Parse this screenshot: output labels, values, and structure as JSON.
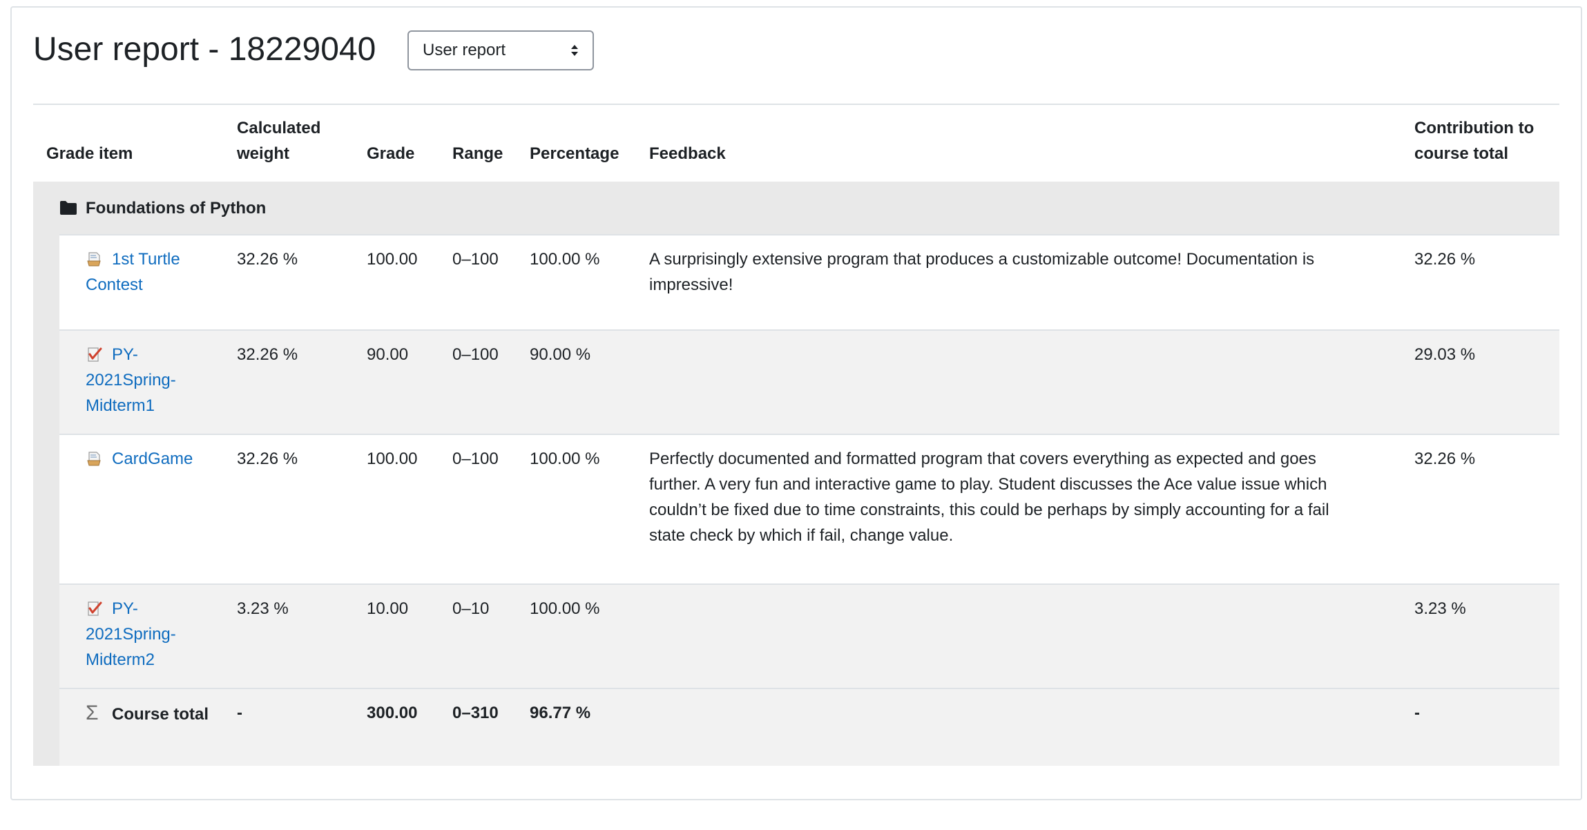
{
  "page": {
    "title": "User report - 18229040",
    "report_select": {
      "value": "User report"
    }
  },
  "table": {
    "headers": {
      "grade_item": "Grade item",
      "calculated_weight": "Calculated weight",
      "grade": "Grade",
      "range": "Range",
      "percentage": "Percentage",
      "feedback": "Feedback",
      "contribution": "Contribution to course total"
    },
    "category": {
      "name": "Foundations of Python",
      "icon": "folder-icon"
    },
    "rows": [
      {
        "name": "1st Turtle Contest",
        "icon": "assignment-icon",
        "weight": "32.26 %",
        "grade": "100.00",
        "range": "0–100",
        "percentage": "100.00 %",
        "feedback": "A surprisingly extensive program that produces a customizable outcome! Documentation is impressive!",
        "contribution": "32.26 %"
      },
      {
        "name": "PY-2021Spring-Midterm1",
        "icon": "quiz-icon",
        "weight": "32.26 %",
        "grade": "90.00",
        "range": "0–100",
        "percentage": "90.00 %",
        "feedback": "",
        "contribution": "29.03 %"
      },
      {
        "name": "CardGame",
        "icon": "assignment-icon",
        "weight": "32.26 %",
        "grade": "100.00",
        "range": "0–100",
        "percentage": "100.00 %",
        "feedback": "Perfectly documented and formatted program that covers everything as expected and goes further. A very fun and interactive game to play. Student discusses the Ace value issue which couldn’t be fixed due to time constraints, this could be perhaps by simply accounting for a fail state check by which if fail, change value.",
        "contribution": "32.26 %"
      },
      {
        "name": "PY-2021Spring-Midterm2",
        "icon": "quiz-icon",
        "weight": "3.23 %",
        "grade": "10.00",
        "range": "0–10",
        "percentage": "100.00 %",
        "feedback": "",
        "contribution": "3.23 %"
      }
    ],
    "total": {
      "label": "Course total",
      "icon": "sigma-icon",
      "weight": "-",
      "grade": "300.00",
      "range": "0–310",
      "percentage": "96.77 %",
      "feedback": "",
      "contribution": "-"
    }
  },
  "colors": {
    "link": "#0f6cbf",
    "category_bg": "#e9e9e9",
    "row_alt_bg": "#f2f2f2",
    "border": "#dee2e6"
  }
}
